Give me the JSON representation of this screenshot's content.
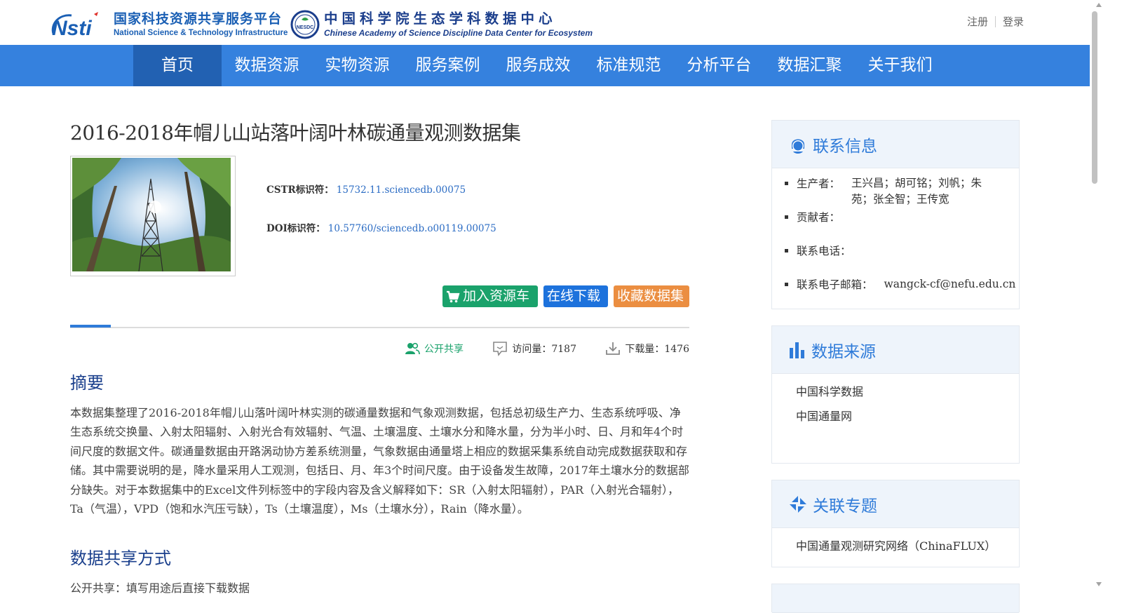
{
  "header": {
    "logo1": {
      "cn": "国家科技资源共享服务平台",
      "en": "National Science & Technology Infrastructure",
      "mark": "nsti"
    },
    "logo2": {
      "cn": "中国科学院生态学科数据中心",
      "en": "Chinese Academy of Science Discipline Data Center for Ecosystem",
      "badge": "NESDC"
    },
    "register": "注册",
    "login": "登录"
  },
  "nav": {
    "items": [
      "首页",
      "数据资源",
      "实物资源",
      "服务案例",
      "服务成效",
      "标准规范",
      "分析平台",
      "数据汇聚",
      "关于我们"
    ],
    "active": "首页"
  },
  "dataset": {
    "title": "2016-2018年帽儿山站落叶阔叶林碳通量观测数据集",
    "cstr_label": "CSTR标识符：",
    "cstr_value": "15732.11.sciencedb.00075",
    "doi_label": "DOI标识符：",
    "doi_value": "10.57760/sciencedb.o00119.00075",
    "buttons": {
      "cart": "加入资源车",
      "download": "在线下载",
      "favorite": "收藏数据集"
    },
    "stats": {
      "share": "公开共享",
      "visits": "访问量：7187",
      "downloads": "下载量：1476"
    }
  },
  "abstract": {
    "heading": "摘要",
    "text": "本数据集整理了2016-2018年帽儿山落叶阔叶林实测的碳通量数据和气象观测数据，包括总初级生产力、生态系统呼吸、净生态系统交换量、入射太阳辐射、入射光合有效辐射、气温、土壤温度、土壤水分和降水量，分为半小时、日、月和年4个时间尺度的数据文件。碳通量数据由开路涡动协方差系统测量，气象数据由通量塔上相应的数据采集系统自动完成数据获取和存储。其中需要说明的是，降水量采用人工观测，包括日、月、年3个时间尺度。由于设备发生故障，2017年土壤水分的数据部分缺失。对于本数据集中的Excel文件列标签中的字段内容及含义解释如下：SR（入射太阳辐射），PAR（入射光合辐射），Ta（气温），VPD（饱和水汽压亏缺），Ts（土壤温度），Ms（土壤水分），Rain（降水量）。"
  },
  "sharing": {
    "heading": "数据共享方式",
    "text": "公开共享：填写用途后直接下载数据"
  },
  "sidebar": {
    "contact": {
      "title": "联系信息",
      "producer_label": "生产者：",
      "producer_value": "王兴昌；胡可铭；刘帆；朱苑；张全智；王传宽",
      "contributor_label": "贡献者：",
      "contributor_value": "",
      "phone_label": "联系电话：",
      "phone_value": "",
      "email_label": "联系电子邮箱：",
      "email_value": "wangck-cf@nefu.edu.cn"
    },
    "source": {
      "title": "数据来源",
      "items": [
        "中国科学数据",
        "中国通量网"
      ]
    },
    "topic": {
      "title": "关联专题",
      "items": [
        "中国通量观测研究网络（ChinaFLUX）"
      ]
    }
  },
  "colors": {
    "nav_bg": "#3581de",
    "nav_active": "#2261b2",
    "heading_blue": "#1a3f8c",
    "cart_green": "#1aa26b",
    "download_blue": "#1d72dc",
    "favorite_orange": "#eb8e41"
  }
}
